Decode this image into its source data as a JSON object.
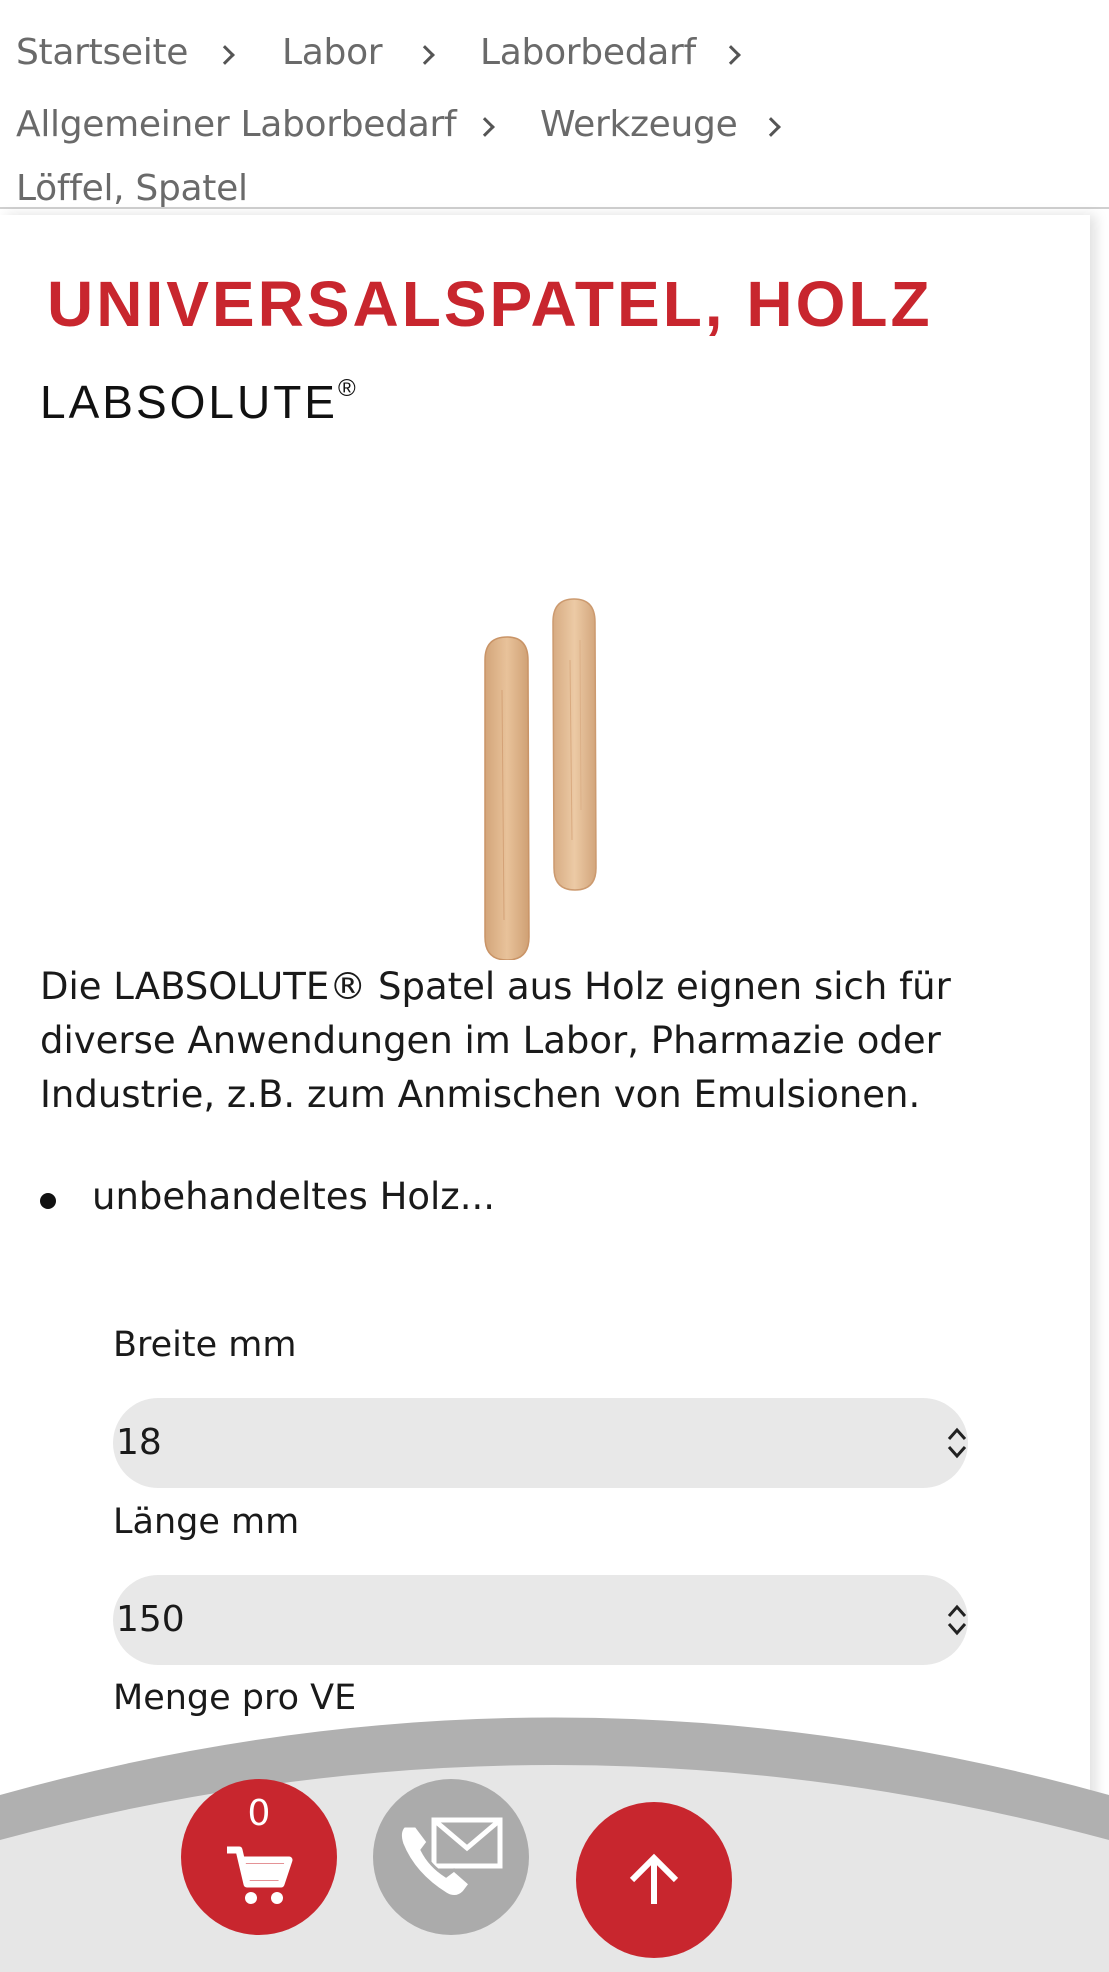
{
  "breadcrumb": {
    "items": [
      "Startseite",
      "Labor",
      "Laborbedarf",
      "Allgemeiner Laborbedarf",
      "Werkzeuge",
      "Löffel, Spatel"
    ]
  },
  "product": {
    "title": "UNIVERSALSPATEL, HOLZ",
    "brand": "LABSOLUTE",
    "brand_mark": "®",
    "description": "Die LABSOLUTE® Spatel aus Holz eignen sich für diverse Anwendungen im Labor, Pharmazie oder Industrie, z.B. zum Anmischen von Emulsionen.",
    "bullets": [
      "unbehandeltes Holz..."
    ]
  },
  "options": {
    "breite": {
      "label": "Breite mm",
      "value": "18"
    },
    "laenge": {
      "label": "Länge mm",
      "value": "150"
    },
    "menge": {
      "label": "Menge pro VE"
    }
  },
  "bottom_bar": {
    "cart_count": "0",
    "icons": [
      "cart-icon",
      "phone-mail-icon",
      "arrow-up-icon"
    ]
  },
  "colors": {
    "accent": "#c8262e",
    "select_bg": "#e8e8e8",
    "bar_gray": "#b0b0b0",
    "bar_light": "#e6e6e6"
  }
}
